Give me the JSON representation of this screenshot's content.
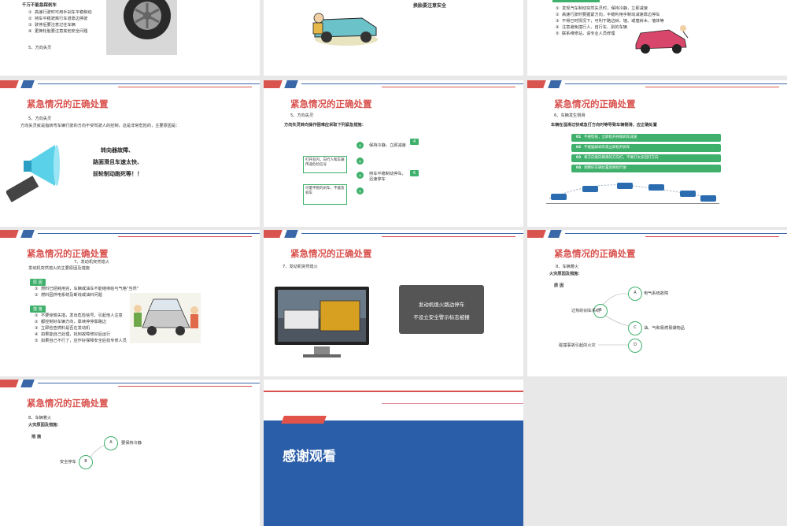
{
  "grid": {
    "s1": {
      "heading": "千万不能急踩刹车",
      "items": [
        "高速行驶时可用手刹车平稳制动",
        "持车平稳驶离行车道靠边停驶",
        "驶停后要注意过往车辆",
        "更换轮胎要注意其他安全问题"
      ],
      "footnote": "5、方向失灵"
    },
    "s2": {
      "caption": "换胎要注意安全"
    },
    "s3": {
      "items": [
        "发现汽车制动突然失灵时，保持冷静，立即减速",
        "高速行驶时要握紧方向，平稳利用手制动减速靠边停车",
        "不得已时情况下，可利于路边树、墙、或撞树木、墙体等",
        "注意避免撞行人、自行车、别的车辆",
        "联系维修站，请专业人员修理"
      ]
    },
    "s4": {
      "title": "紧急情况的正确处置",
      "sub": "5、方向失灵",
      "desc": "方向失灵就是指转弯车辆行驶的方向不受驾驶人的控制，这是非常危险的，主要原因是：",
      "causes": [
        "转向器故障、",
        "路面滑且车速太快、",
        "前轮制动跑死等！！"
      ]
    },
    "s5": {
      "title": "紧急情况的正确处置",
      "sub": "5、方向失灵",
      "desc": "方向失灵转向操作困难应采取下列紧急措施：",
      "steps": [
        "打开双闪，向行人和车辆传递危险信号",
        "保持冷静，立即减速",
        "持车平稳制动停车，迅速停车",
        "尽量平稳的刹车，不能急刹车"
      ],
      "nums": [
        "4",
        "5",
        "6"
      ]
    },
    "s6": {
      "title": "紧急情况的正确处置",
      "sub": "6、车辆发生侧滑",
      "desc": "车辆在湿滑过快或急打方向时等导致车辆侧滑，应正确处置",
      "rows": [
        {
          "n": "01",
          "t": "不要慌张，立即松开并踩刹车减速"
        },
        {
          "n": "02",
          "t": "不能猛踩刹车或立即松开刹车"
        },
        {
          "n": "03",
          "t": "将方向盘向侧滑的方向打，不要打太多回打方向"
        },
        {
          "n": "04",
          "t": "调整好车辆位置后继续行驶"
        }
      ]
    },
    "s7": {
      "title": "紧急情况的正确处置",
      "sub": "7、发动机突然熄火",
      "desc": "发动机突然熄火的主要原因及措施",
      "reason_tag": "原 因",
      "reasons": [
        "燃料已经耗用完，车辆或油车不能继续给与气格\"当然\"",
        "燃料因供电系统及断线或油料问题"
      ],
      "measure_tag": "措 施",
      "measures": [
        "不要惊慌失措，发出危险信号，引起他人注意",
        "都控制好车辆方向，靠续停停靠路边",
        "立即检查燃料是否在发动机",
        "如果能自己处理，找到故障修好后运行",
        "如果自己不行了，应作好保障安全后找专修人员"
      ]
    },
    "s8": {
      "title": "紧急情况的正确处置",
      "sub": "7、发动机突然熄火",
      "lines": [
        "发动机熄火路边停车",
        "不设立安全警示标志被撞"
      ]
    },
    "s9": {
      "title": "紧急情况的正确处置",
      "sub": "8、车辆着火",
      "desc": "火灾原因及措施：",
      "tag": "原 因",
      "nodes": [
        {
          "k": "A",
          "t": "电气系统故障"
        },
        {
          "k": "B",
          "t": "过热的刹车系统"
        },
        {
          "k": "C",
          "t": "油、气和易燃易爆物品"
        },
        {
          "k": "D",
          "t": "碰撞事故引起的火灾"
        }
      ]
    },
    "s10": {
      "title": "紧急情况的正确处置",
      "sub": "8、车辆着火",
      "desc": "火灾原因及措施：",
      "tag": "措 施",
      "nodes": [
        {
          "k": "A",
          "t": "要保持冷静"
        },
        {
          "k": "B",
          "t": "安全停车"
        }
      ]
    },
    "s11": {
      "title": "感谢观看"
    }
  },
  "colors": {
    "red": "#d9534f",
    "blue": "#3a67a8",
    "green": "#3fb06b"
  }
}
